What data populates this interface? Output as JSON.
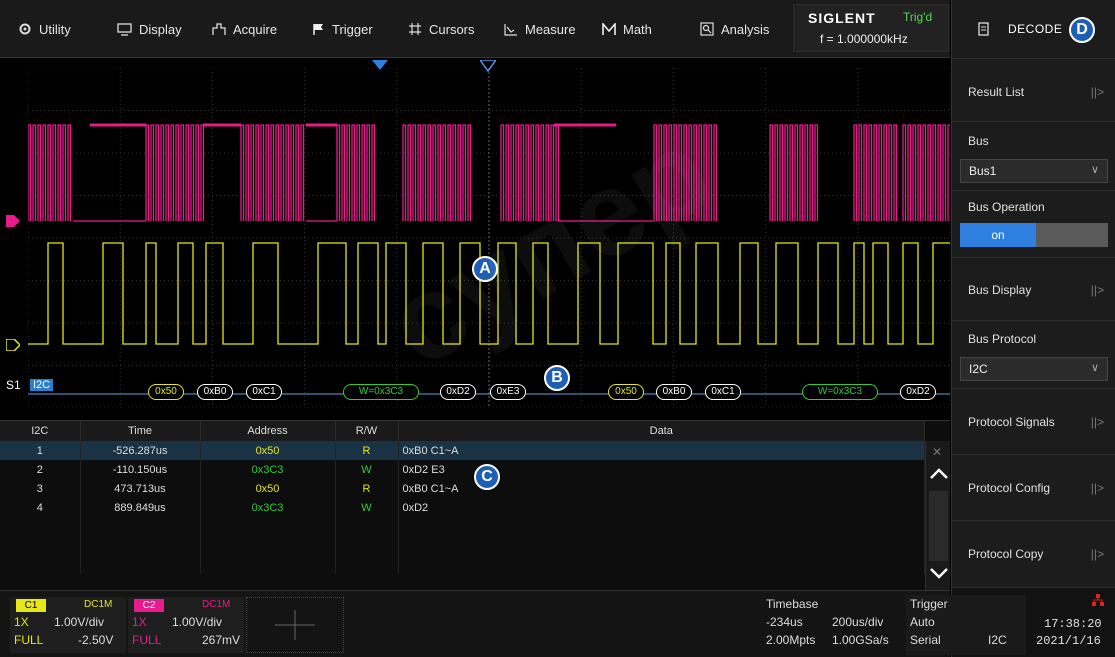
{
  "menu": {
    "items": [
      {
        "label": "Utility",
        "icon": "gear-icon"
      },
      {
        "label": "Display",
        "icon": "monitor-icon"
      },
      {
        "label": "Acquire",
        "icon": "acquire-icon"
      },
      {
        "label": "Trigger",
        "icon": "flag-icon"
      },
      {
        "label": "Cursors",
        "icon": "cursors-icon"
      },
      {
        "label": "Measure",
        "icon": "measure-icon"
      },
      {
        "label": "Math",
        "icon": "math-icon"
      },
      {
        "label": "Analysis",
        "icon": "analysis-icon"
      }
    ]
  },
  "brand": {
    "name": "SIGLENT",
    "trig_state": "Trig'd",
    "frequency": "f = 1.000000kHz"
  },
  "panel": {
    "title": "DECODE",
    "marker": "D",
    "result_list": "Result List",
    "bus_label": "Bus",
    "bus_value": "Bus1",
    "bus_operation_label": "Bus Operation",
    "bus_operation_value": "on",
    "bus_display": "Bus Display",
    "bus_protocol_label": "Bus Protocol",
    "bus_protocol_value": "I2C",
    "protocol_signals": "Protocol Signals",
    "protocol_config": "Protocol Config",
    "protocol_copy": "Protocol Copy"
  },
  "waveform": {
    "channel1_color": "#e81a8c",
    "channel2_color": "#e6e619",
    "bus_label": "S1",
    "bus_protocol": "I2C",
    "markers": {
      "a": "A",
      "b": "B",
      "c": "C"
    },
    "decode_frames": [
      {
        "text": "0x50",
        "color": "#e6e619"
      },
      {
        "text": "0xB0",
        "color": "#ffffff"
      },
      {
        "text": "0xC1",
        "color": "#ffffff"
      },
      {
        "text": "W=0x3C3",
        "color": "#33cc33"
      },
      {
        "text": "0xD2",
        "color": "#ffffff"
      },
      {
        "text": "0xE3",
        "color": "#ffffff"
      },
      {
        "text": "0x50",
        "color": "#e6e619"
      },
      {
        "text": "0xB0",
        "color": "#ffffff"
      },
      {
        "text": "0xC1",
        "color": "#ffffff"
      },
      {
        "text": "W=0x3C3",
        "color": "#33cc33"
      },
      {
        "text": "0xD2",
        "color": "#ffffff"
      }
    ]
  },
  "table": {
    "headers": [
      "I2C",
      "Time",
      "Address",
      "R/W",
      "Data"
    ],
    "rows": [
      {
        "index": "1",
        "time": "-526.287us",
        "address": "0x50",
        "rw": "R",
        "data": "0xB0 C1~A"
      },
      {
        "index": "2",
        "time": "-110.150us",
        "address": "0x3C3",
        "rw": "W",
        "data": "0xD2 E3"
      },
      {
        "index": "3",
        "time": "473.713us",
        "address": "0x50",
        "rw": "R",
        "data": "0xB0 C1~A"
      },
      {
        "index": "4",
        "time": "889.849us",
        "address": "0x3C3",
        "rw": "W",
        "data": "0xD2"
      }
    ]
  },
  "status": {
    "c1": {
      "tag": "C1",
      "coupling": "DC1M",
      "probe": "1X",
      "scale": "1.00V/div",
      "bw": "FULL",
      "offset": "-2.50V"
    },
    "c2": {
      "tag": "C2",
      "coupling": "DC1M",
      "probe": "1X",
      "scale": "1.00V/div",
      "bw": "FULL",
      "offset": "267mV"
    },
    "timebase": {
      "label": "Timebase",
      "delay": "-234us",
      "scale": "200us/div",
      "memory": "2.00Mpts",
      "rate": "1.00GSa/s"
    },
    "trigger": {
      "label": "Trigger",
      "mode": "Auto",
      "type": "Serial",
      "source": "I2C"
    },
    "clock": {
      "time": "17:38:20",
      "date": "2021/1/16"
    }
  },
  "watermark": "супер"
}
